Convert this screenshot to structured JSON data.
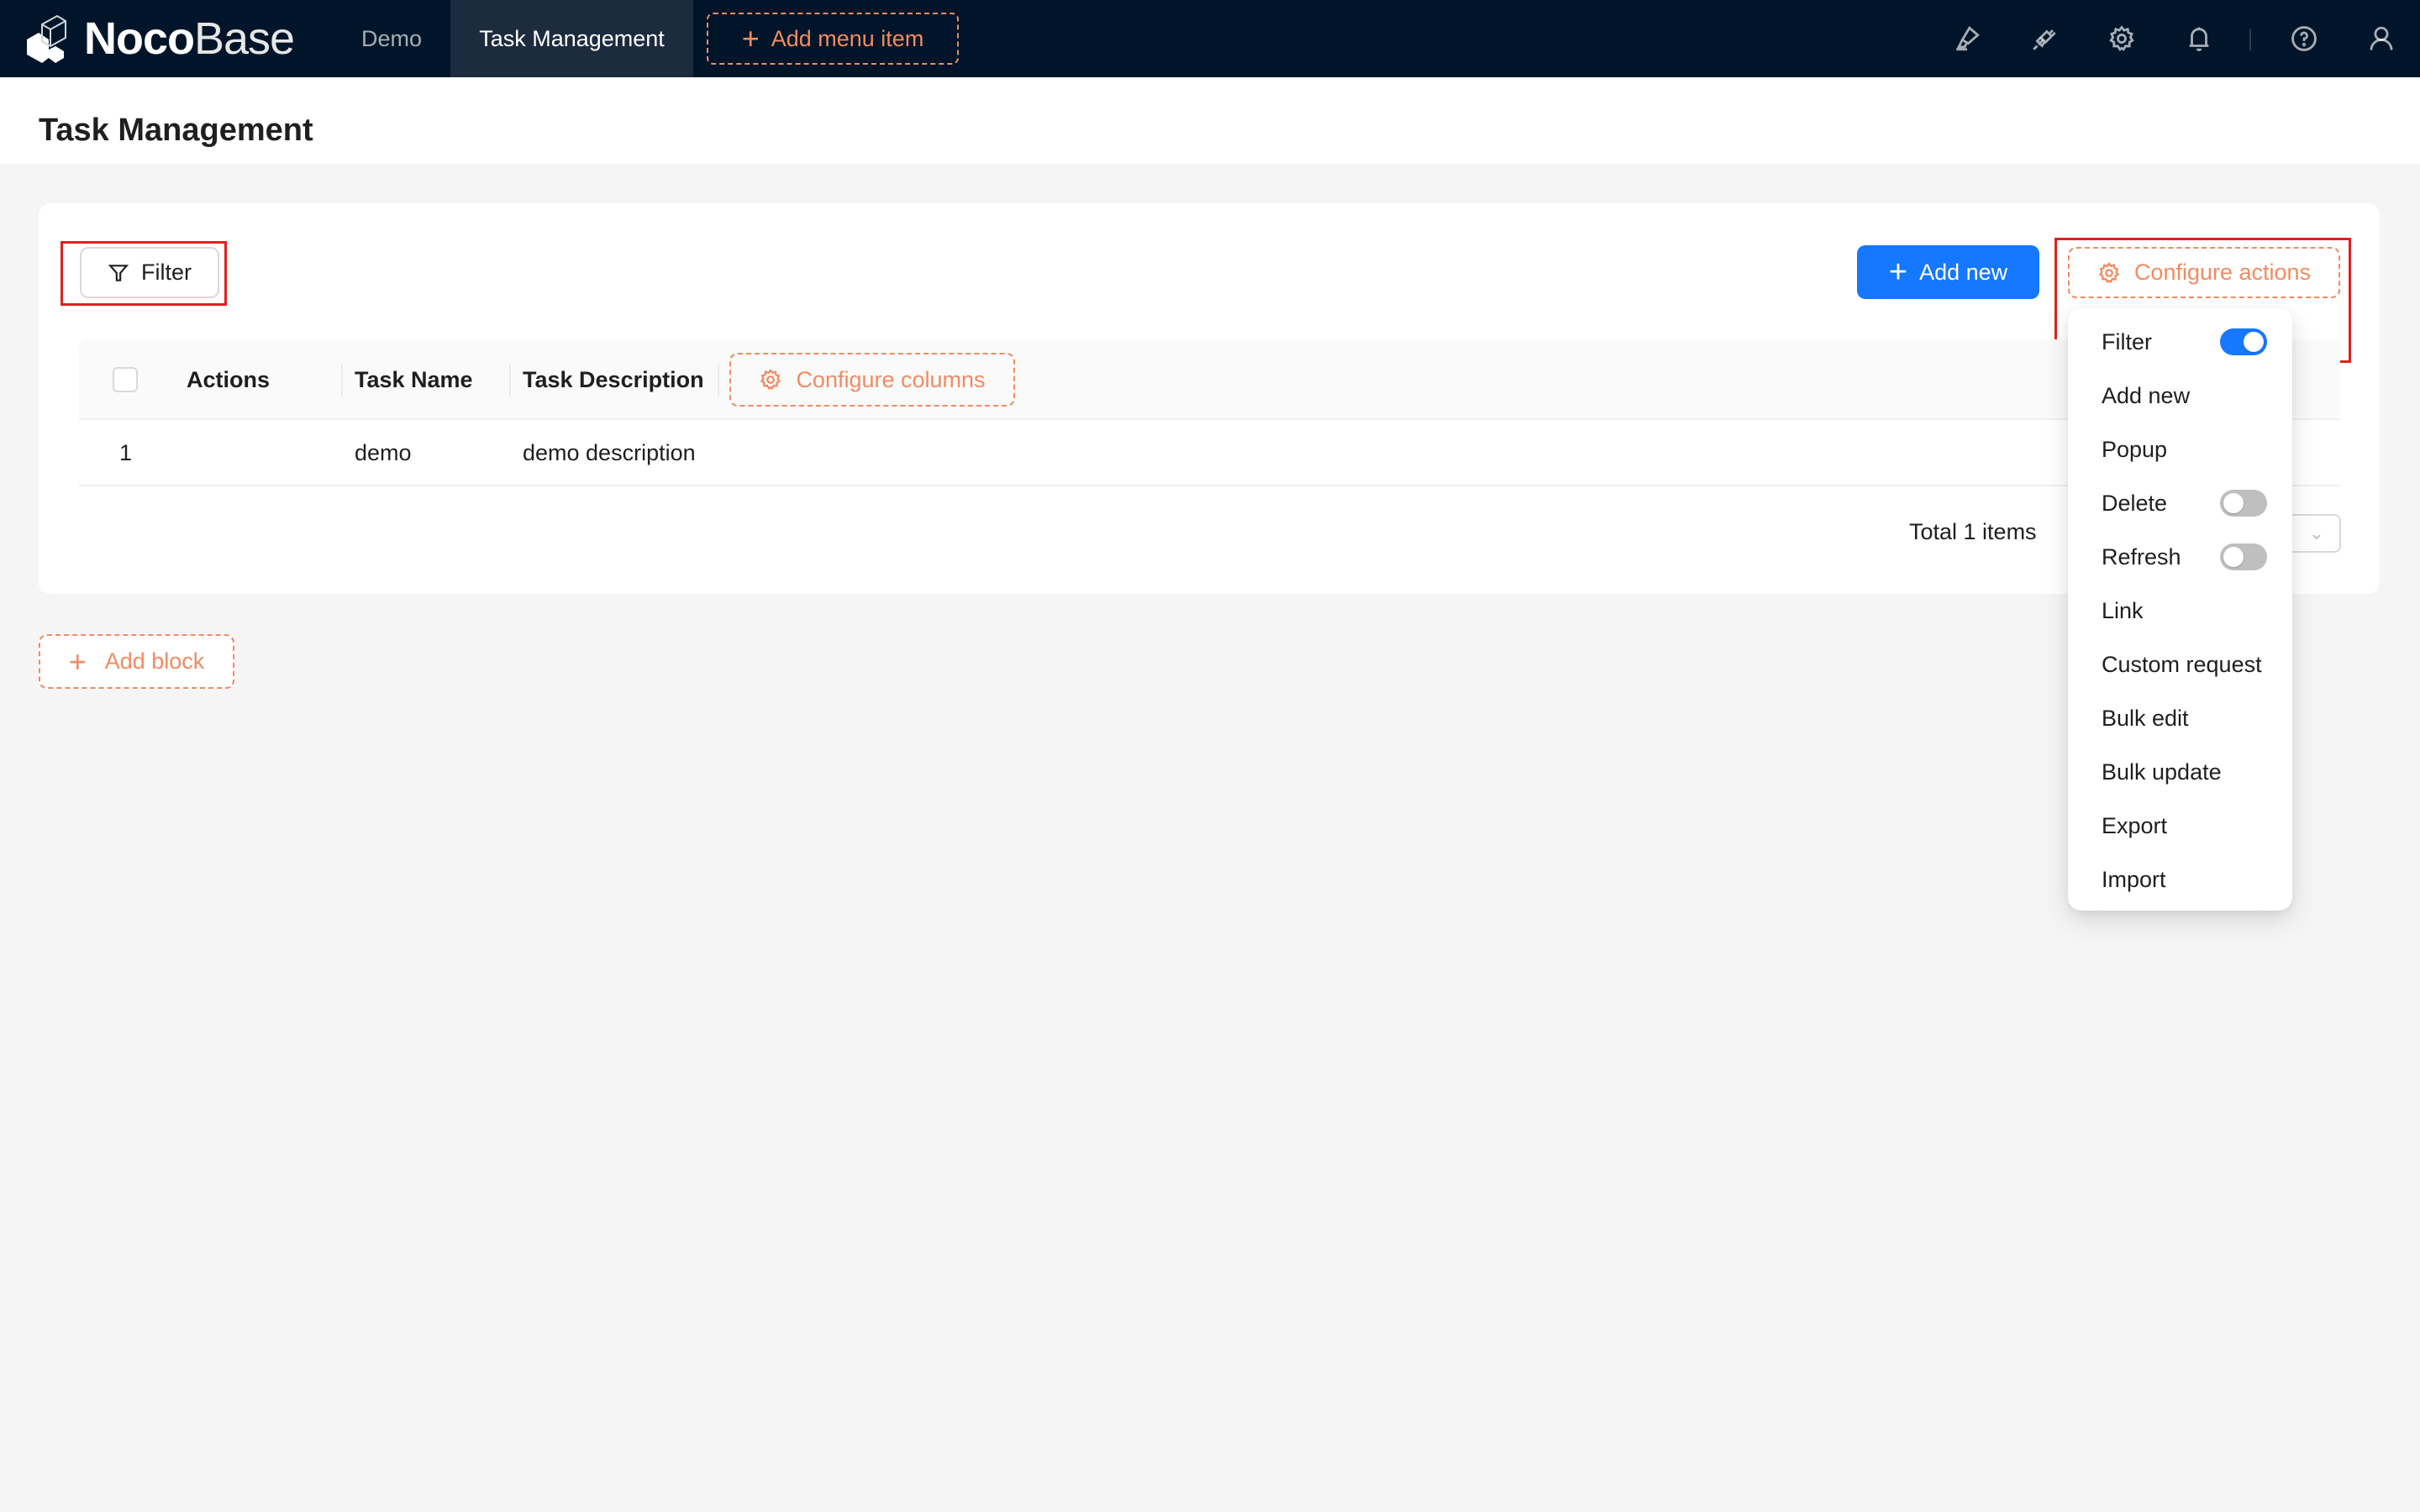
{
  "header": {
    "logo": {
      "bold": "Noco",
      "light": "Base"
    },
    "nav": [
      {
        "label": "Demo",
        "active": false
      },
      {
        "label": "Task Management",
        "active": true
      }
    ],
    "add_menu_item_label": "Add menu item",
    "icons": [
      "ui-editor-icon",
      "plugin-icon",
      "settings-icon",
      "notification-bell-icon",
      "help-icon",
      "user-icon"
    ]
  },
  "page": {
    "title": "Task Management"
  },
  "block": {
    "filter_label": "Filter",
    "add_new_label": "Add new",
    "configure_actions_label": "Configure actions",
    "table": {
      "columns": [
        "Actions",
        "Task Name",
        "Task Description"
      ],
      "configure_columns_label": "Configure columns",
      "rows": [
        {
          "index": "1",
          "task_name": "demo",
          "task_description": "demo description"
        }
      ]
    },
    "pagination": {
      "total_text": "Total 1 items"
    }
  },
  "add_block_label": "Add block",
  "configure_actions_menu": {
    "items": [
      {
        "label": "Filter",
        "toggle": true,
        "checked": true
      },
      {
        "label": "Add new"
      },
      {
        "label": "Popup"
      },
      {
        "label": "Delete",
        "toggle": true,
        "checked": false
      },
      {
        "label": "Refresh",
        "toggle": true,
        "checked": false
      },
      {
        "label": "Link"
      },
      {
        "label": "Custom request"
      },
      {
        "label": "Bulk edit"
      },
      {
        "label": "Bulk update"
      },
      {
        "label": "Export"
      },
      {
        "label": "Import"
      }
    ]
  },
  "colors": {
    "header_bg": "#001529",
    "primary": "#1677ff",
    "design_accent": "#f18b62",
    "highlight_box": "#e02020"
  }
}
